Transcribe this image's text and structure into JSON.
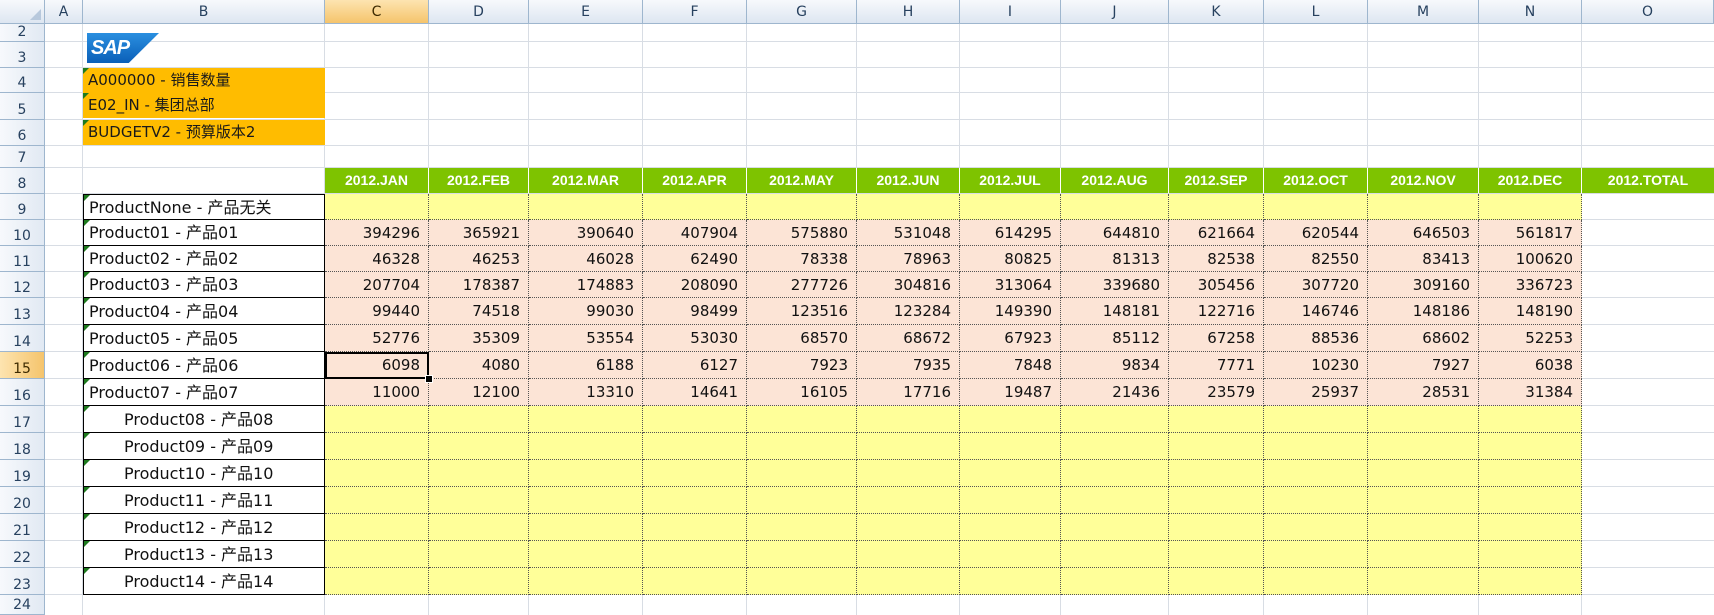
{
  "columns": [
    "A",
    "B",
    "C",
    "D",
    "E",
    "F",
    "G",
    "H",
    "I",
    "J",
    "K",
    "L",
    "M",
    "N",
    "O"
  ],
  "rows": [
    "2",
    "3",
    "4",
    "5",
    "6",
    "7",
    "8",
    "9",
    "10",
    "11",
    "12",
    "13",
    "14",
    "15",
    "16",
    "17",
    "18",
    "19",
    "20",
    "21",
    "22",
    "23",
    "24"
  ],
  "selected_cell": "C15",
  "logo_text": "SAP",
  "info_labels": [
    "A000000 - 销售数量",
    "E02_IN - 集团总部",
    "BUDGETV2 - 预算版本2"
  ],
  "month_headers": [
    "2012.JAN",
    "2012.FEB",
    "2012.MAR",
    "2012.APR",
    "2012.MAY",
    "2012.JUN",
    "2012.JUL",
    "2012.AUG",
    "2012.SEP",
    "2012.OCT",
    "2012.NOV",
    "2012.DEC",
    "2012.TOTAL"
  ],
  "products": [
    {
      "label": "ProductNone - 产品无关",
      "indent": false,
      "values": []
    },
    {
      "label": "Product01 - 产品01",
      "indent": false,
      "values": [
        "394296",
        "365921",
        "390640",
        "407904",
        "575880",
        "531048",
        "614295",
        "644810",
        "621664",
        "620544",
        "646503",
        "561817"
      ]
    },
    {
      "label": "Product02 - 产品02",
      "indent": false,
      "values": [
        "46328",
        "46253",
        "46028",
        "62490",
        "78338",
        "78963",
        "80825",
        "81313",
        "82538",
        "82550",
        "83413",
        "100620"
      ]
    },
    {
      "label": "Product03 - 产品03",
      "indent": false,
      "values": [
        "207704",
        "178387",
        "174883",
        "208090",
        "277726",
        "304816",
        "313064",
        "339680",
        "305456",
        "307720",
        "309160",
        "336723"
      ]
    },
    {
      "label": "Product04 - 产品04",
      "indent": false,
      "values": [
        "99440",
        "74518",
        "99030",
        "98499",
        "123516",
        "123284",
        "149390",
        "148181",
        "122716",
        "146746",
        "148186",
        "148190"
      ]
    },
    {
      "label": "Product05 - 产品05",
      "indent": false,
      "values": [
        "52776",
        "35309",
        "53554",
        "53030",
        "68570",
        "68672",
        "67923",
        "85112",
        "67258",
        "88536",
        "68602",
        "52253"
      ]
    },
    {
      "label": "Product06 - 产品06",
      "indent": false,
      "values": [
        "6098",
        "4080",
        "6188",
        "6127",
        "7923",
        "7935",
        "7848",
        "9834",
        "7771",
        "10230",
        "7927",
        "6038"
      ]
    },
    {
      "label": "Product07 - 产品07",
      "indent": false,
      "values": [
        "11000",
        "12100",
        "13310",
        "14641",
        "16105",
        "17716",
        "19487",
        "21436",
        "23579",
        "25937",
        "28531",
        "31384"
      ]
    },
    {
      "label": "Product08 - 产品08",
      "indent": true,
      "values": []
    },
    {
      "label": "Product09 - 产品09",
      "indent": true,
      "values": []
    },
    {
      "label": "Product10 - 产品10",
      "indent": true,
      "values": []
    },
    {
      "label": "Product11 - 产品11",
      "indent": true,
      "values": []
    },
    {
      "label": "Product12 - 产品12",
      "indent": true,
      "values": []
    },
    {
      "label": "Product13 - 产品13",
      "indent": true,
      "values": []
    },
    {
      "label": "Product14 - 产品14",
      "indent": true,
      "values": []
    }
  ],
  "colors": {
    "header_green": "#7ec300",
    "info_orange": "#ffbc00",
    "data_pink": "#fce4d6",
    "input_yellow": "#ffff99"
  }
}
